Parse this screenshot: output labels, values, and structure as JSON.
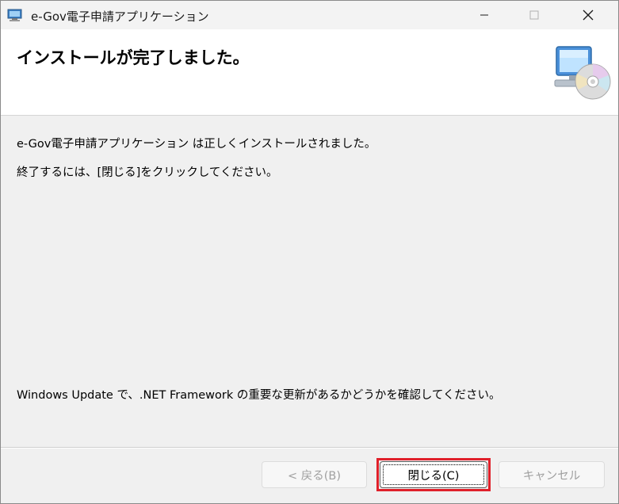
{
  "window": {
    "title": "e-Gov電子申請アプリケーション"
  },
  "header": {
    "title": "インストールが完了しました。",
    "graphic_icon": "computer-cd-icon"
  },
  "body": {
    "line1": "e-Gov電子申請アプリケーション は正しくインストールされました。",
    "line2": "終了するには、[閉じる]をクリックしてください。",
    "line3": "Windows Update で、.NET Framework の重要な更新があるかどうかを確認してください。"
  },
  "buttons": {
    "back": "< 戻る(B)",
    "close": "閉じる(C)",
    "cancel": "キャンセル"
  },
  "colors": {
    "highlight": "#e0202a"
  }
}
